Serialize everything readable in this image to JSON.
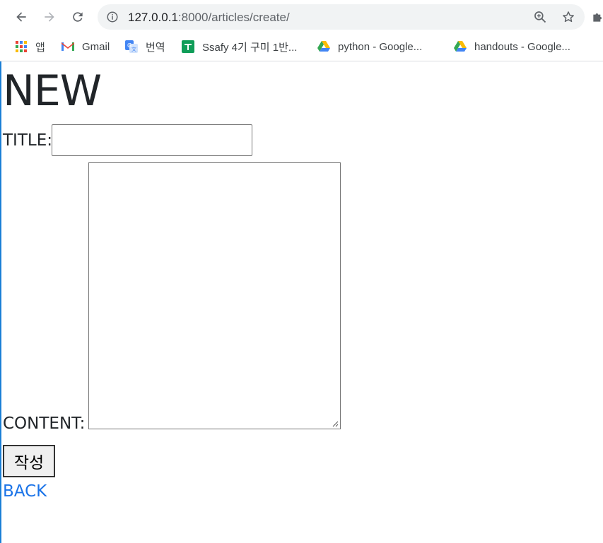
{
  "browser": {
    "url_host": "127.0.0.1",
    "url_rest": ":8000/articles/create/"
  },
  "bookmarks": [
    {
      "label": "앱",
      "icon": "apps-grid-icon"
    },
    {
      "label": "Gmail",
      "icon": "gmail-icon"
    },
    {
      "label": "번역",
      "icon": "google-translate-icon"
    },
    {
      "label": "Ssafy 4기 구미 1반...",
      "icon": "google-sheets-icon"
    },
    {
      "label": "python - Google...",
      "icon": "google-drive-icon"
    },
    {
      "label": "handouts - Google...",
      "icon": "google-drive-icon"
    }
  ],
  "page": {
    "title": "NEW",
    "title_label": "TITLE:",
    "title_value": "",
    "content_label": "CONTENT:",
    "content_value": "",
    "submit_label": "작성",
    "back_label": "BACK"
  },
  "colors": {
    "link": "#1a73e8",
    "text": "#212529",
    "omnibox_bg": "#f1f3f4"
  }
}
